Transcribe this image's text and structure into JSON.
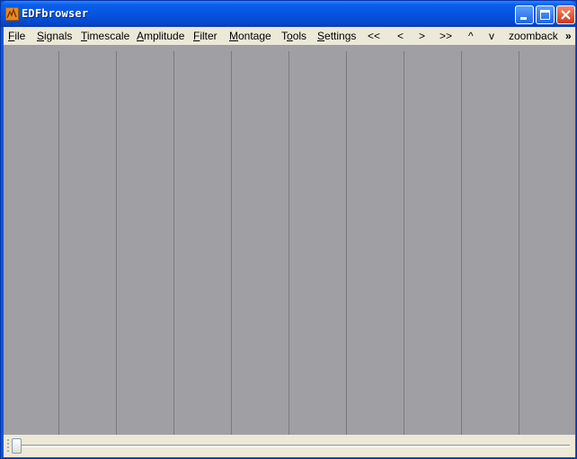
{
  "window": {
    "title": "EDFbrowser",
    "controls": {
      "minimize": "minimize-icon",
      "maximize": "maximize-icon",
      "close": "close-icon"
    }
  },
  "menu": {
    "items": [
      {
        "key": "F",
        "rest": "ile"
      },
      {
        "key": "S",
        "rest": "ignals"
      },
      {
        "key": "T",
        "rest": "imescale"
      },
      {
        "key": "A",
        "rest": "mplitude"
      },
      {
        "key": "F",
        "rest": "ilter"
      },
      {
        "key": "M",
        "rest": "ontage"
      },
      {
        "key": "To",
        "rest": "ols",
        "underline_index": 1
      },
      {
        "key": "S",
        "rest": "ettings"
      }
    ],
    "nav": [
      "<<",
      "<",
      ">",
      ">>",
      "^",
      "v",
      "zoomback"
    ],
    "overflow": "»"
  },
  "timeline": {
    "slider_position": 0
  },
  "colors": {
    "plot_background": "#a09fa4",
    "grid_line": "#7c7b80",
    "menubar": "#ece9d8",
    "titlebar": "#0555e0"
  }
}
